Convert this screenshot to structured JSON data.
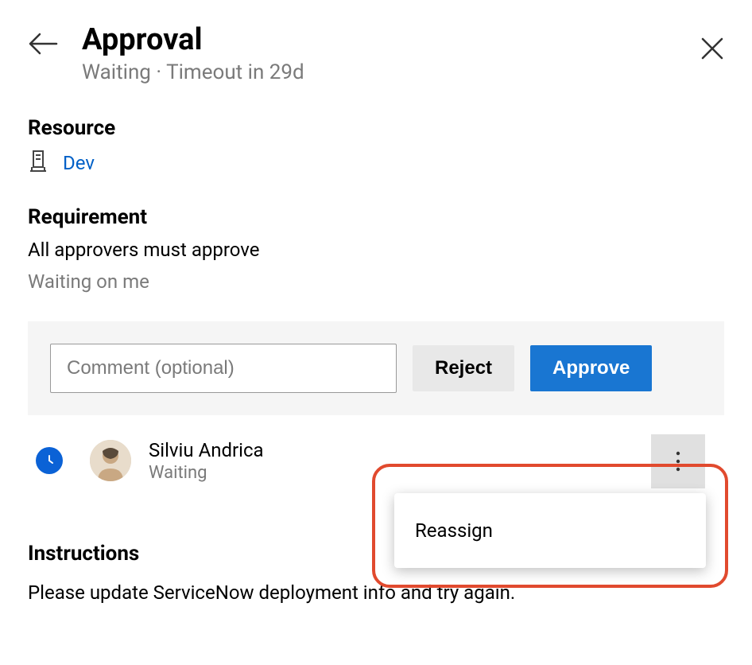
{
  "header": {
    "title": "Approval",
    "status": "Waiting",
    "separator": " · ",
    "timeout": "Timeout in 29d"
  },
  "resource": {
    "heading": "Resource",
    "name": "Dev"
  },
  "requirement": {
    "heading": "Requirement",
    "text": "All approvers must approve",
    "waiting": "Waiting on me"
  },
  "actions": {
    "comment_placeholder": "Comment (optional)",
    "reject_label": "Reject",
    "approve_label": "Approve"
  },
  "approver": {
    "name": "Silviu Andrica",
    "status": "Waiting"
  },
  "menu": {
    "reassign": "Reassign"
  },
  "instructions": {
    "heading": "Instructions",
    "text": "Please update ServiceNow deployment info and try again."
  }
}
